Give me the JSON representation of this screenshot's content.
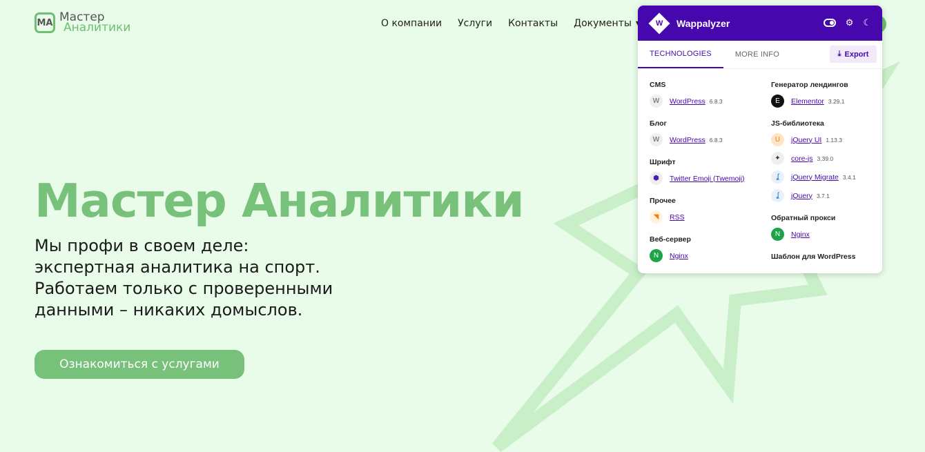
{
  "header": {
    "logo_mark": "МА",
    "logo_line1": "Мастер",
    "logo_line2": "Аналитики",
    "nav": [
      {
        "label": "О компании"
      },
      {
        "label": "Услуги"
      },
      {
        "label": "Контакты"
      },
      {
        "label": "Документы"
      }
    ]
  },
  "hero": {
    "title": "Мастер Аналитики",
    "subtitle_lines": [
      "Мы профи в своем деле:",
      "экспертная аналитика на спорт.",
      "Работаем только с проверенными",
      "данными – никаких домыслов."
    ],
    "cta_label": "Ознакомиться с услугами"
  },
  "wappalyzer": {
    "name": "Wappalyzer",
    "tabs": [
      {
        "label": "TECHNOLOGIES"
      },
      {
        "label": "MORE INFO"
      }
    ],
    "export_label": "Export",
    "left": [
      {
        "category": "CMS",
        "items": [
          {
            "name": "WordPress",
            "version": "6.8.3",
            "icon": "wordpress-icon"
          }
        ]
      },
      {
        "category": "Блог",
        "items": [
          {
            "name": "WordPress",
            "version": "6.8.3",
            "icon": "wordpress-icon"
          }
        ]
      },
      {
        "category": "Шрифт",
        "items": [
          {
            "name": "Twitter Emoji (Twemoji)",
            "version": "",
            "icon": "twemoji-icon"
          }
        ]
      },
      {
        "category": "Прочее",
        "items": [
          {
            "name": "RSS",
            "version": "",
            "icon": "rss-icon"
          }
        ]
      },
      {
        "category": "Веб-сервер",
        "items": [
          {
            "name": "Nginx",
            "version": "",
            "icon": "nginx-icon"
          }
        ]
      }
    ],
    "right": [
      {
        "category": "Генератор лендингов",
        "items": [
          {
            "name": "Elementor",
            "version": "3.29.1",
            "icon": "elementor-icon"
          }
        ]
      },
      {
        "category": "JS-библиотека",
        "items": [
          {
            "name": "jQuery UI",
            "version": "1.13.3",
            "icon": "jquery-ui-icon"
          },
          {
            "name": "core-js",
            "version": "3.39.0",
            "icon": "core-js-icon"
          },
          {
            "name": "jQuery Migrate",
            "version": "3.4.1",
            "icon": "jquery-icon"
          },
          {
            "name": "jQuery",
            "version": "3.7.1",
            "icon": "jquery-icon"
          }
        ]
      },
      {
        "category": "Обратный прокси",
        "items": [
          {
            "name": "Nginx",
            "version": "",
            "icon": "nginx-icon"
          }
        ]
      },
      {
        "category": "Шаблон для WordPress",
        "items": []
      }
    ]
  },
  "colors": {
    "background": "#e9fbe9",
    "brand_green": "#77c17b",
    "wappalyzer_purple": "#4608ad"
  }
}
